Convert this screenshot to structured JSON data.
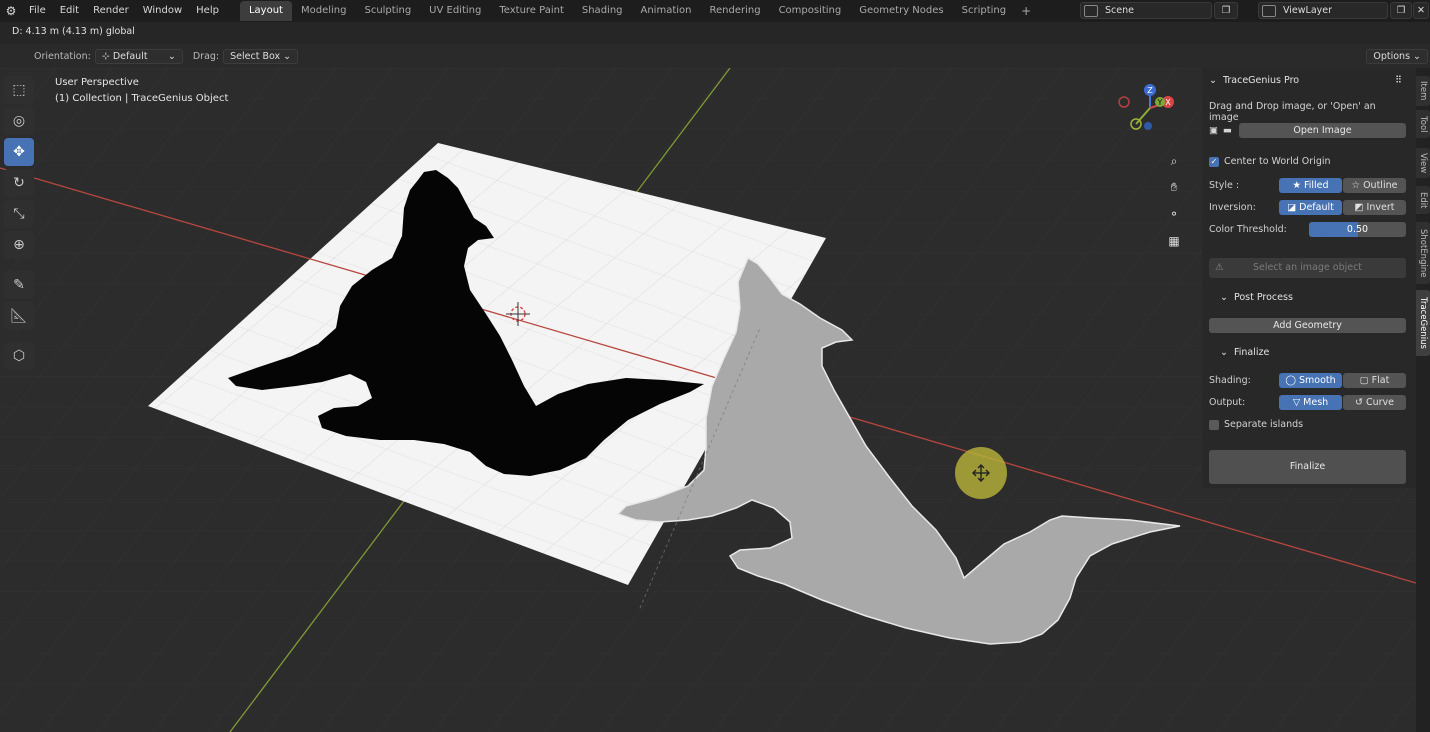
{
  "topbar": {
    "menu": [
      "File",
      "Edit",
      "Render",
      "Window",
      "Help"
    ],
    "workspaces": [
      "Layout",
      "Modeling",
      "Sculpting",
      "UV Editing",
      "Texture Paint",
      "Shading",
      "Animation",
      "Rendering",
      "Compositing",
      "Geometry Nodes",
      "Scripting"
    ],
    "active_workspace": "Layout",
    "scene": "Scene",
    "view_layer": "ViewLayer"
  },
  "status_line": "D: 4.13 m (4.13 m) global",
  "header": {
    "orientation_label": "Orientation:",
    "orientation_value": "Default",
    "drag_label": "Drag:",
    "drag_value": "Select Box",
    "options": "Options"
  },
  "viewport": {
    "line1": "User Perspective",
    "line2": "(1) Collection | TraceGenius Object",
    "gizmo": {
      "x": "X",
      "y": "Y",
      "z": "Z"
    }
  },
  "panel": {
    "title": "TraceGenius Pro",
    "hint": "Drag and Drop image, or 'Open' an image",
    "open_image": "Open Image",
    "center_label": "Center to World Origin",
    "style_label": "Style :",
    "style_filled": "Filled",
    "style_outline": "Outline",
    "inversion_label": "Inversion:",
    "inv_default": "Default",
    "inv_invert": "Invert",
    "threshold_label": "Color Threshold:",
    "threshold_value": "0.50",
    "warning": "Select an image object",
    "post_process": "Post Process",
    "add_geometry": "Add Geometry",
    "finalize_section": "Finalize",
    "shading_label": "Shading:",
    "shade_smooth": "Smooth",
    "shade_flat": "Flat",
    "output_label": "Output:",
    "out_mesh": "Mesh",
    "out_curve": "Curve",
    "separate_islands": "Separate islands",
    "finalize_button": "Finalize"
  },
  "side_tabs": [
    "Item",
    "Tool",
    "View",
    "Edit",
    "ShotEngine",
    "TraceGenius"
  ],
  "colors": {
    "accent": "#4772b3",
    "x_axis": "#c24a4a",
    "y_axis": "#8aa33a",
    "cursor_highlight": "#c7c23a"
  }
}
